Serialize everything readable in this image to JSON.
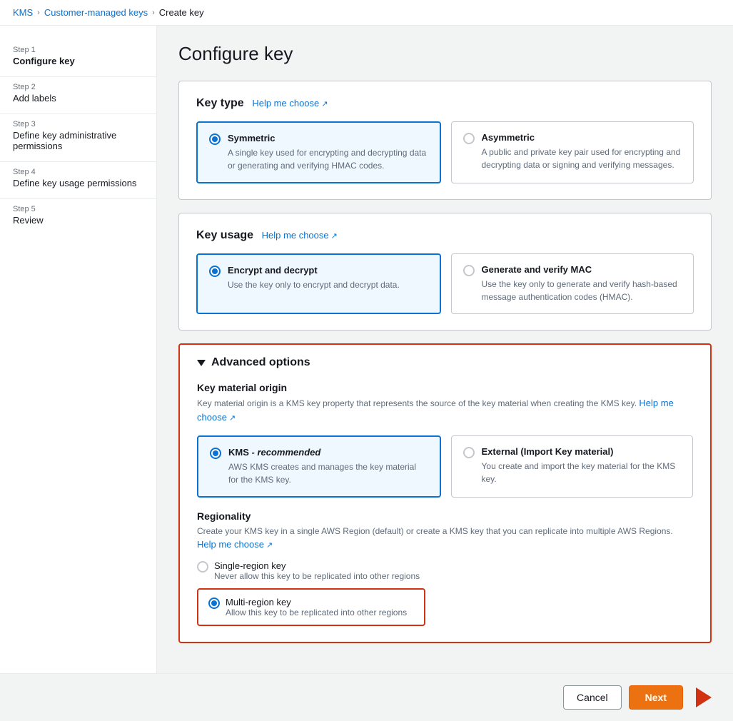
{
  "breadcrumb": {
    "kms": "KMS",
    "customer_managed_keys": "Customer-managed keys",
    "create_key": "Create key"
  },
  "sidebar": {
    "steps": [
      {
        "num": "Step 1",
        "label": "Configure key",
        "active": true
      },
      {
        "num": "Step 2",
        "label": "Add labels",
        "active": false
      },
      {
        "num": "Step 3",
        "label": "Define key administrative permissions",
        "active": false
      },
      {
        "num": "Step 4",
        "label": "Define key usage permissions",
        "active": false
      },
      {
        "num": "Step 5",
        "label": "Review",
        "active": false
      }
    ]
  },
  "main": {
    "title": "Configure key",
    "key_type": {
      "section_title": "Key type",
      "help_link": "Help me choose",
      "options": [
        {
          "id": "symmetric",
          "title": "Symmetric",
          "desc": "A single key used for encrypting and decrypting data or generating and verifying HMAC codes.",
          "selected": true
        },
        {
          "id": "asymmetric",
          "title": "Asymmetric",
          "desc": "A public and private key pair used for encrypting and decrypting data or signing and verifying messages.",
          "selected": false
        }
      ]
    },
    "key_usage": {
      "section_title": "Key usage",
      "help_link": "Help me choose",
      "options": [
        {
          "id": "encrypt_decrypt",
          "title": "Encrypt and decrypt",
          "desc": "Use the key only to encrypt and decrypt data.",
          "selected": true
        },
        {
          "id": "generate_verify_mac",
          "title": "Generate and verify MAC",
          "desc": "Use the key only to generate and verify hash-based message authentication codes (HMAC).",
          "selected": false
        }
      ]
    },
    "advanced_options": {
      "title": "Advanced options",
      "key_material_origin": {
        "title": "Key material origin",
        "desc": "Key material origin is a KMS key property that represents the source of the key material when creating the KMS key.",
        "help_link": "Help me choose",
        "options": [
          {
            "id": "kms",
            "title": "KMS",
            "title_suffix": "- recommended",
            "desc": "AWS KMS creates and manages the key material for the KMS key.",
            "selected": true
          },
          {
            "id": "external",
            "title": "External (Import Key material)",
            "desc": "You create and import the key material for the KMS key.",
            "selected": false
          }
        ]
      },
      "regionality": {
        "title": "Regionality",
        "desc": "Create your KMS key in a single AWS Region (default) or create a KMS key that you can replicate into multiple AWS Regions.",
        "help_link": "Help me choose",
        "options": [
          {
            "id": "single_region",
            "title": "Single-region key",
            "desc": "Never allow this key to be replicated into other regions",
            "selected": false
          },
          {
            "id": "multi_region",
            "title": "Multi-region key",
            "desc": "Allow this key to be replicated into other regions",
            "selected": true
          }
        ]
      }
    }
  },
  "footer": {
    "cancel_label": "Cancel",
    "next_label": "Next"
  }
}
